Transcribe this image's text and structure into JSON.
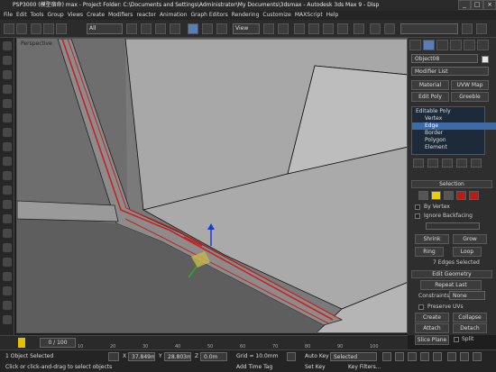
{
  "title": "PSP3000 (模型宿命) max - Project Folder: C:\\Documents and Settings\\Administrator\\My Documents\\3dsmax - Autodesk 3ds Max 9 - Disp",
  "menu": [
    "File",
    "Edit",
    "Tools",
    "Group",
    "Views",
    "Create",
    "Modifiers",
    "reactor",
    "Animation",
    "Graph Editors",
    "Rendering",
    "Customize",
    "MAXScript",
    "Help"
  ],
  "toolbar": {
    "selection_filter": "All",
    "ref_coord": "View",
    "named_sel": ""
  },
  "viewport": {
    "label": "Perspective"
  },
  "panel": {
    "object_name": "Object08",
    "modifier_list": "Modifier List",
    "btn_material": "Material",
    "btn_uvw": "UVW Map",
    "btn_editpoly": "Edit Poly",
    "btn_greeble": "Greeble",
    "stack": [
      "Editable Poly",
      "Vertex",
      "Edge",
      "Border",
      "Polygon",
      "Element"
    ],
    "selected_stack": "Edge",
    "rollout_selection": "Selection",
    "by_vertex": "By Vertex",
    "ignore_backfacing": "Ignore Backfacing",
    "shrink": "Shrink",
    "grow": "Grow",
    "ring": "Ring",
    "loop": "Loop",
    "edges_selected": "7 Edges Selected",
    "rollout_edit_geometry": "Edit Geometry",
    "repeat_last": "Repeat Last",
    "constraints_label": "Constraints:",
    "constraints_value": "None",
    "preserve_uvs": "Preserve UVs",
    "create": "Create",
    "collapse": "Collapse",
    "attach": "Attach",
    "detach": "Detach",
    "slice_plane": "Slice Plane",
    "split": "Split"
  },
  "timeline": {
    "slider": "0 / 100",
    "ticks": [
      "0",
      "10",
      "20",
      "30",
      "40",
      "50",
      "60",
      "70",
      "80",
      "90",
      "100"
    ]
  },
  "status": {
    "objects": "1 Object Selected",
    "prompt": "Click or click-and-drag to select objects",
    "x_label": "X",
    "x": "37.849m",
    "y_label": "Y",
    "y": "28.803m",
    "z_label": "Z",
    "z": "0.0m",
    "grid": "Grid = 10.0mm",
    "add_time_tag": "Add Time Tag",
    "auto_key": "Auto Key",
    "set_key": "Set Key",
    "key_mode": "Selected",
    "key_filters": "Key Filters..."
  },
  "colors": {
    "edge_highlight": "#cc2020",
    "panel_bg": "#2e2e2e",
    "viewport_bg": "#7a7a7a"
  }
}
